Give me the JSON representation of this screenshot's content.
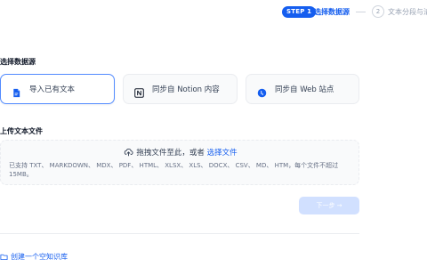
{
  "stepper": {
    "step1_badge": "STEP 1",
    "step1_label": "选择数据源",
    "step2_number": "2",
    "step2_label": "文本分段与清洗"
  },
  "source": {
    "title": "选择数据源",
    "options": [
      {
        "label": "导入已有文本",
        "icon": "file-text-icon",
        "selected": true
      },
      {
        "label": "同步自 Notion 内容",
        "icon": "notion-icon",
        "selected": false
      },
      {
        "label": "同步自 Web 站点",
        "icon": "web-globe-icon",
        "selected": false
      }
    ]
  },
  "upload": {
    "title": "上传文本文件",
    "drag_text": "拖拽文件至此，或者",
    "select_link": "选择文件",
    "hint": "已支持 TXT、 MARKDOWN、 MDX、 PDF、 HTML、 XLSX、 XLS、 DOCX、 CSV、 MD、 HTM，每个文件不超过 15MB。",
    "icon": "upload-cloud-icon"
  },
  "actions": {
    "next_label": "下一步 →",
    "create_empty_label": "创建一个空知识库",
    "create_icon": "folder-icon"
  },
  "colors": {
    "primary": "#155eef",
    "selected_border": "#528bff",
    "disabled_button": "#d1e0ff"
  }
}
